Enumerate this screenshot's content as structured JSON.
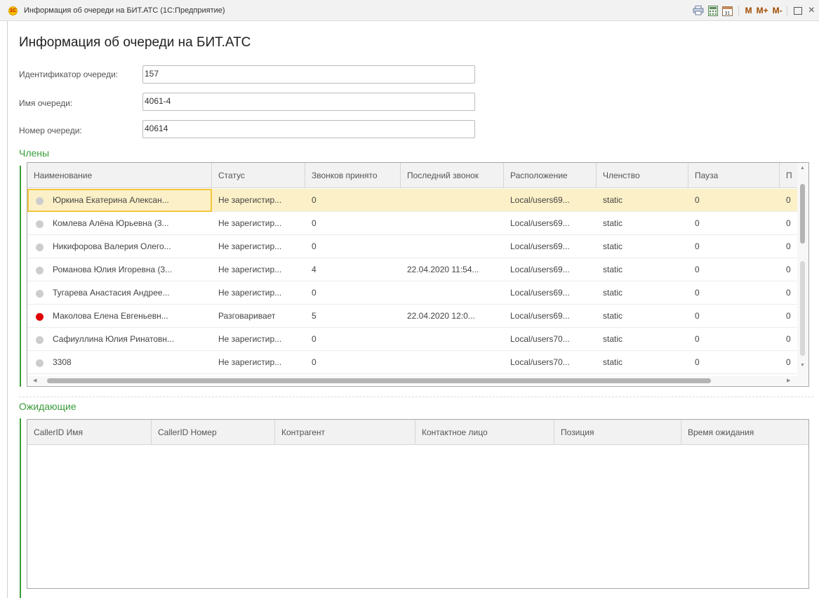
{
  "window": {
    "title": "Информация об очереди на БИТ.АТС  (1С:Предприятие)",
    "logo": "1С",
    "toolbar": {
      "m": "M",
      "m_plus": "M+",
      "m_minus": "M-",
      "calendar_day": "31"
    }
  },
  "page_title": "Информация об очереди на БИТ.АТС",
  "fields": {
    "queue_id": {
      "label": "Идентификатор очереди:",
      "value": "157"
    },
    "queue_name": {
      "label": "Имя очереди:",
      "value": "4061-4"
    },
    "queue_number": {
      "label": "Номер очереди:",
      "value": "40614"
    }
  },
  "members": {
    "title": "Члены",
    "columns": [
      "Наименование",
      "Статус",
      "Звонков принято",
      "Последний звонок",
      "Расположение",
      "Членство",
      "Пауза",
      "П"
    ],
    "rows": [
      {
        "name": "Юркина Екатерина Алексан...",
        "status": "Не зарегистир...",
        "calls": "0",
        "last_call": "",
        "location": "Local/users69...",
        "membership": "static",
        "pause": "0",
        "p": "0",
        "status_color": "gray"
      },
      {
        "name": "Комлева Алёна Юрьевна (3...",
        "status": "Не зарегистир...",
        "calls": "0",
        "last_call": "",
        "location": "Local/users69...",
        "membership": "static",
        "pause": "0",
        "p": "0",
        "status_color": "gray"
      },
      {
        "name": "Никифорова Валерия Олего...",
        "status": "Не зарегистир...",
        "calls": "0",
        "last_call": "",
        "location": "Local/users69...",
        "membership": "static",
        "pause": "0",
        "p": "0",
        "status_color": "gray"
      },
      {
        "name": "Романова Юлия Игоревна (3...",
        "status": "Не зарегистир...",
        "calls": "4",
        "last_call": "22.04.2020 11:54...",
        "location": "Local/users69...",
        "membership": "static",
        "pause": "0",
        "p": "0",
        "status_color": "gray"
      },
      {
        "name": "Тугарева Анастасия Андрее...",
        "status": "Не зарегистир...",
        "calls": "0",
        "last_call": "",
        "location": "Local/users69...",
        "membership": "static",
        "pause": "0",
        "p": "0",
        "status_color": "gray"
      },
      {
        "name": "Маколова Елена Евгеньевн...",
        "status": "Разговаривает",
        "calls": "5",
        "last_call": "22.04.2020 12:0...",
        "location": "Local/users69...",
        "membership": "static",
        "pause": "0",
        "p": "0",
        "status_color": "red"
      },
      {
        "name": "Сафиуллина Юлия Ринатовн...",
        "status": "Не зарегистир...",
        "calls": "0",
        "last_call": "",
        "location": "Local/users70...",
        "membership": "static",
        "pause": "0",
        "p": "0",
        "status_color": "gray"
      },
      {
        "name": "3308",
        "status": "Не зарегистир...",
        "calls": "0",
        "last_call": "",
        "location": "Local/users70...",
        "membership": "static",
        "pause": "0",
        "p": "0",
        "status_color": "gray"
      }
    ]
  },
  "waiting": {
    "title": "Ожидающие",
    "columns": [
      "CallerID Имя",
      "CallerID Номер",
      "Контрагент",
      "Контактное лицо",
      "Позиция",
      "Время ожидания"
    ],
    "rows": []
  },
  "colors": {
    "accent_green": "#3a9c3a",
    "selected_row": "#fbf0c7",
    "focus_border": "#f3c73c",
    "status_red": "#e00000",
    "status_gray": "#cdcdcd"
  }
}
